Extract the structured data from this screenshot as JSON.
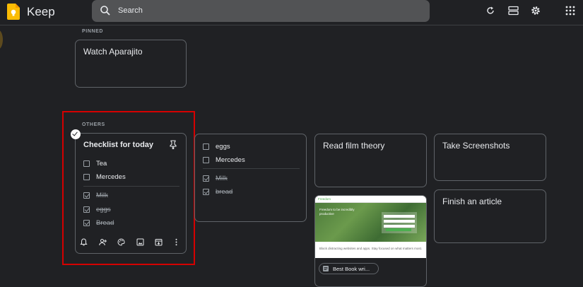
{
  "app": {
    "title": "Keep"
  },
  "search": {
    "placeholder": "Search"
  },
  "toolbar": {
    "icons": [
      "refresh-icon",
      "list-view-icon",
      "settings-icon",
      "apps-grid-icon"
    ]
  },
  "sections": {
    "pinned": "PINNED",
    "others": "OTHERS"
  },
  "notes": {
    "pinned": [
      {
        "title": "Watch Aparajito"
      }
    ],
    "checklist": {
      "title": "Checklist for today",
      "unchecked": [
        "Tea",
        "Mercedes"
      ],
      "checked": [
        "Milk",
        "eggs",
        "Bread"
      ]
    },
    "checklist2": {
      "unchecked": [
        "eggs",
        "Mercedes"
      ],
      "checked": [
        "Milk",
        "bread"
      ]
    },
    "film": {
      "title": "Read film theory"
    },
    "screenshots": {
      "title": "Take Screenshots"
    },
    "article": {
      "title": "Finish an article"
    },
    "link": {
      "brand": "Freedom",
      "hero": "Freedom to be incredibly productive",
      "caption": "Block distracting websites and apps. Stay focused on what matters most.",
      "chip_label": "Best Book wri..."
    }
  },
  "colors": {
    "background": "#202124",
    "highlight": "#d50000",
    "logo": "#fbbc04"
  }
}
